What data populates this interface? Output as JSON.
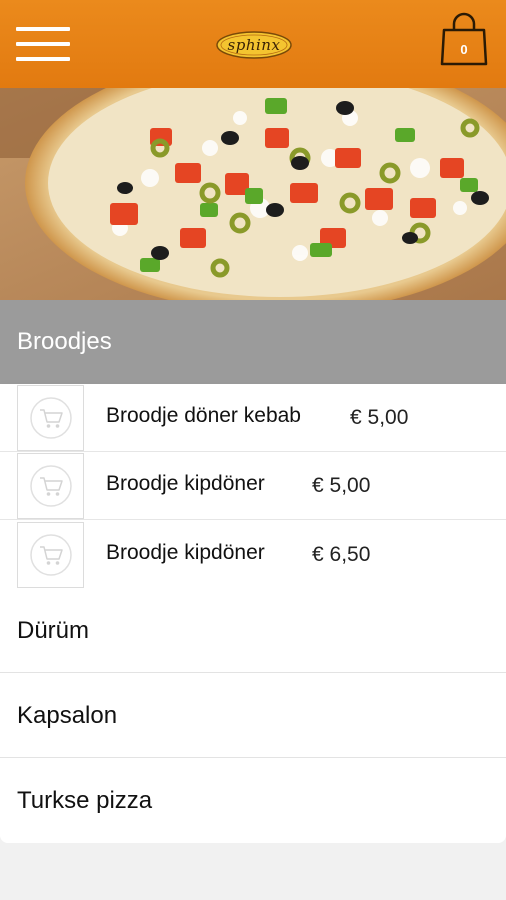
{
  "header": {
    "menu_icon": "hamburger-menu-icon",
    "logo_text": "sphinx",
    "cart_icon": "shopping-bag-icon",
    "cart_count": "0",
    "colors": {
      "header_bg": "#e8841a",
      "accent": "#f0a020"
    }
  },
  "hero": {
    "image": "pizza-image"
  },
  "category": {
    "title": "Broodjes",
    "products": [
      {
        "name": "Broodje döner kebab",
        "price": "€ 5,00",
        "icon": "add-to-cart-icon"
      },
      {
        "name": "Broodje kipdöner",
        "price": "€ 5,00",
        "icon": "add-to-cart-icon"
      },
      {
        "name": "Broodje kipdöner",
        "price": "€ 6,50",
        "icon": "add-to-cart-icon"
      }
    ]
  },
  "categories": [
    {
      "label": "Dürüm"
    },
    {
      "label": "Kapsalon"
    },
    {
      "label": "Turkse pizza"
    }
  ]
}
